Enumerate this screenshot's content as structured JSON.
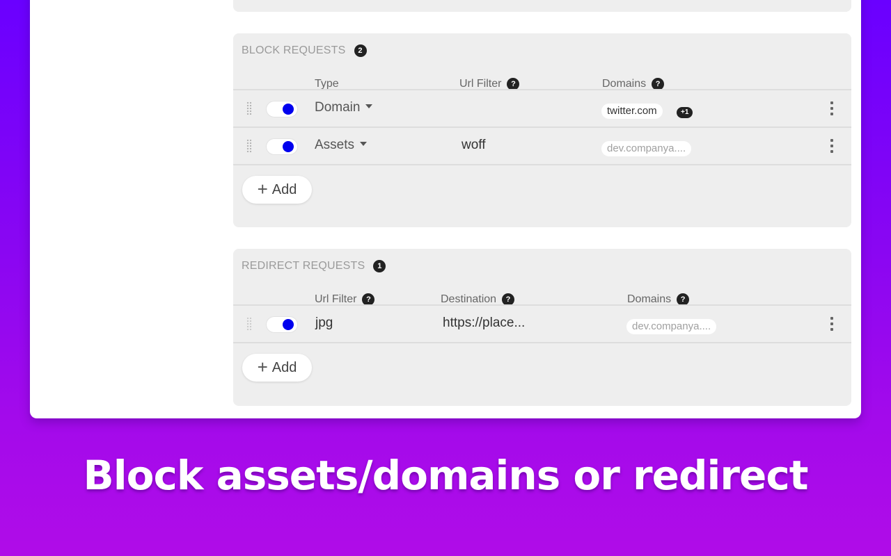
{
  "colors": {
    "background_top": "#6a00ff",
    "background_bottom": "#b00ce8",
    "toggle_on": "#0000ee",
    "panel": "#eeeeee"
  },
  "block_requests": {
    "title": "BLOCK REQUESTS",
    "count": "2",
    "columns": [
      {
        "label": "Type",
        "help": false
      },
      {
        "label": "Url Filter",
        "help": true,
        "help_glyph": "?"
      },
      {
        "label": "Domains",
        "help": true,
        "help_glyph": "?"
      }
    ],
    "rows": [
      {
        "enabled": true,
        "type": "Domain",
        "url_filter": "",
        "domains": [
          "twitter.com"
        ],
        "extra_domains": "+1"
      },
      {
        "enabled": true,
        "type": "Assets",
        "url_filter": "woff",
        "domains": [
          "dev.companya...."
        ],
        "extra_domains": null
      }
    ],
    "add_label": "Add"
  },
  "redirect_requests": {
    "title": "REDIRECT REQUESTS",
    "count": "1",
    "columns": [
      {
        "label": "Url Filter",
        "help": true,
        "help_glyph": "?"
      },
      {
        "label": "Destination",
        "help": true,
        "help_glyph": "?"
      },
      {
        "label": "Domains",
        "help": true,
        "help_glyph": "?"
      }
    ],
    "rows": [
      {
        "enabled": true,
        "url_filter": "jpg",
        "destination": "https://place...",
        "domains": [
          "dev.companya...."
        ]
      }
    ],
    "add_label": "Add"
  },
  "icons": {
    "drag": "drag-handle-icon",
    "menu": "kebab-menu-icon",
    "add": "plus-icon",
    "help": "help-icon",
    "caret": "caret-down-icon"
  },
  "caption": "Block assets/domains or redirect"
}
